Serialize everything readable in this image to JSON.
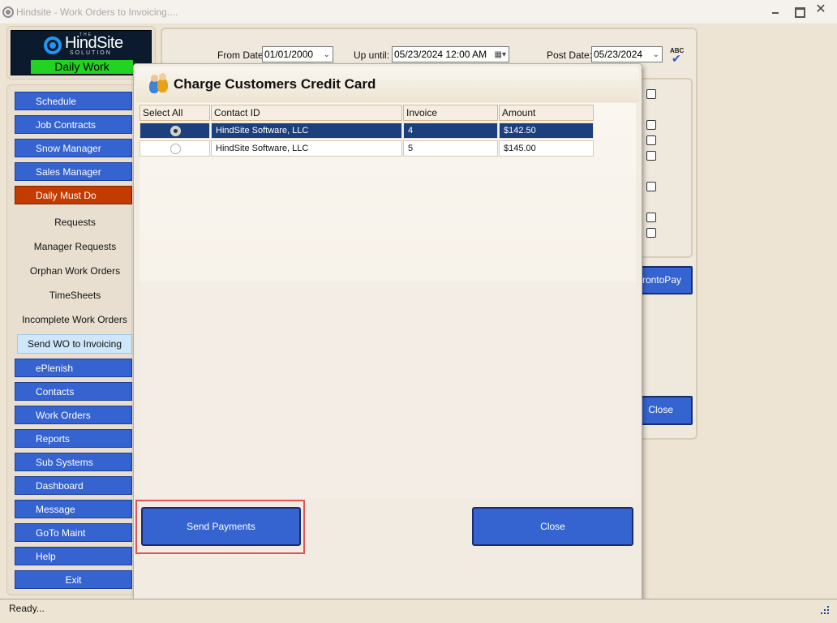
{
  "window": {
    "title": "Hindsite - Work Orders to Invoicing....",
    "close_glyph": "✕"
  },
  "logo": {
    "the": "THE",
    "name": "HindSite",
    "sub": "SOLUTION",
    "badge": "Daily Work"
  },
  "sidebar": {
    "items": [
      {
        "label": "Schedule",
        "kind": "button"
      },
      {
        "label": "Job Contracts",
        "kind": "button"
      },
      {
        "label": "Snow Manager",
        "kind": "button"
      },
      {
        "label": "Sales Manager",
        "kind": "button"
      },
      {
        "label": "Daily Must Do",
        "kind": "button-active"
      },
      {
        "label": "Requests",
        "kind": "link"
      },
      {
        "label": "Manager Requests",
        "kind": "link"
      },
      {
        "label": "Orphan Work Orders",
        "kind": "link"
      },
      {
        "label": "TimeSheets",
        "kind": "link"
      },
      {
        "label": "Incomplete Work Orders",
        "kind": "link"
      },
      {
        "label": "Send WO to Invoicing",
        "kind": "link-selected"
      },
      {
        "label": "ePlenish",
        "kind": "button"
      },
      {
        "label": "Contacts",
        "kind": "button"
      },
      {
        "label": "Work Orders",
        "kind": "button"
      },
      {
        "label": "Reports",
        "kind": "button"
      },
      {
        "label": "Sub Systems",
        "kind": "button"
      },
      {
        "label": "Dashboard",
        "kind": "button"
      },
      {
        "label": "Message",
        "kind": "button"
      },
      {
        "label": "GoTo Maint",
        "kind": "button"
      },
      {
        "label": "Help",
        "kind": "button"
      },
      {
        "label": "Exit",
        "kind": "button-center"
      }
    ]
  },
  "filters": {
    "from_label": "From Date:",
    "from_value": "01/01/2000",
    "upto_label": "Up until:",
    "upto_value": "05/23/2024 12:00 AM",
    "post_label": "Post Date:",
    "post_value": "05/23/2024",
    "spellcheck_text": "ABC"
  },
  "background_buttons": {
    "prontopay": "ProntoPay",
    "close": "Close"
  },
  "dialog": {
    "title": "Charge Customers Credit Card",
    "columns": [
      "Select All",
      "Contact ID",
      "Invoice",
      "Amount"
    ],
    "rows": [
      {
        "selected": true,
        "contact": "HindSite Software, LLC",
        "invoice": "4",
        "amount": "$142.50"
      },
      {
        "selected": false,
        "contact": "HindSite Software, LLC",
        "invoice": "5",
        "amount": "$145.00"
      }
    ],
    "send_button": "Send Payments",
    "close_button": "Close"
  },
  "status": {
    "text": "Ready..."
  },
  "colors": {
    "nav_blue": "#3563cf",
    "nav_orange": "#c43b00",
    "selected_row": "#1c3f7e",
    "logo_green": "#22d322",
    "highlight_red": "#e05555"
  }
}
